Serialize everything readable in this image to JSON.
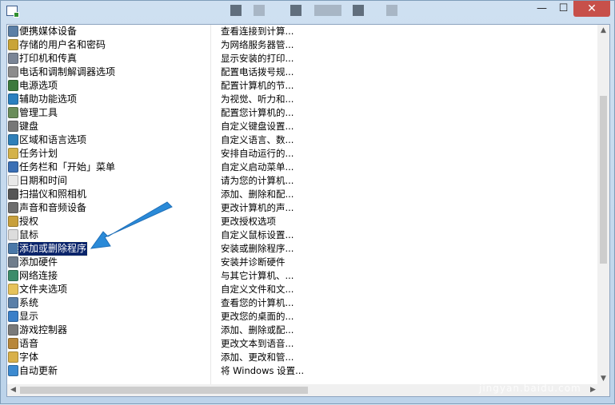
{
  "titlebar": {
    "min_label": "—",
    "max_label": "☐",
    "close_label": "✕"
  },
  "list": {
    "items": [
      {
        "name": "便携媒体设备",
        "desc": "查看连接到计算...",
        "icon": "portable-device-icon",
        "color": "#5b7fa6"
      },
      {
        "name": "存储的用户名和密码",
        "desc": "为网络服务器管...",
        "icon": "key-icon",
        "color": "#c9a437"
      },
      {
        "name": "打印机和传真",
        "desc": "显示安装的打印...",
        "icon": "printer-icon",
        "color": "#7a8596"
      },
      {
        "name": "电话和调制解调器选项",
        "desc": "配置电话拨号规...",
        "icon": "phone-icon",
        "color": "#8c8c8c"
      },
      {
        "name": "电源选项",
        "desc": "配置计算机的节...",
        "icon": "power-icon",
        "color": "#3c7a3c"
      },
      {
        "name": "辅助功能选项",
        "desc": "为视觉、听力和...",
        "icon": "accessibility-icon",
        "color": "#2a7fbf"
      },
      {
        "name": "管理工具",
        "desc": "配置您计算机的...",
        "icon": "admin-tools-icon",
        "color": "#6a8d5a"
      },
      {
        "name": "键盘",
        "desc": "自定义键盘设置...",
        "icon": "keyboard-icon",
        "color": "#777777"
      },
      {
        "name": "区域和语言选项",
        "desc": "自定义语言、数...",
        "icon": "globe-icon",
        "color": "#2f7fb8"
      },
      {
        "name": "任务计划",
        "desc": "安排自动运行的...",
        "icon": "task-scheduler-icon",
        "color": "#d4b24a"
      },
      {
        "name": "任务栏和「开始」菜单",
        "desc": "自定义启动菜单...",
        "icon": "taskbar-icon",
        "color": "#3a6fb5"
      },
      {
        "name": "日期和时间",
        "desc": "请为您的计算机...",
        "icon": "clock-icon",
        "color": "#e9e9e9"
      },
      {
        "name": "扫描仪和照相机",
        "desc": "添加、删除和配...",
        "icon": "scanner-icon",
        "color": "#555555"
      },
      {
        "name": "声音和音频设备",
        "desc": "更改计算机的声...",
        "icon": "speaker-icon",
        "color": "#6e6e6e"
      },
      {
        "name": "授权",
        "desc": "更改授权选项",
        "icon": "license-icon",
        "color": "#c8a03c"
      },
      {
        "name": "鼠标",
        "desc": "自定义鼠标设置...",
        "icon": "mouse-icon",
        "color": "#dcdcdc"
      },
      {
        "name": "添加或删除程序",
        "desc": "安装或删除程序...",
        "icon": "add-remove-programs-icon",
        "color": "#4a78a8",
        "selected": true
      },
      {
        "name": "添加硬件",
        "desc": "安装并诊断硬件",
        "icon": "add-hardware-icon",
        "color": "#6f7d8c"
      },
      {
        "name": "网络连接",
        "desc": "与其它计算机、...",
        "icon": "network-icon",
        "color": "#3c8c6a"
      },
      {
        "name": "文件夹选项",
        "desc": "自定义文件和文...",
        "icon": "folder-icon",
        "color": "#e6c25a"
      },
      {
        "name": "系统",
        "desc": "查看您的计算机...",
        "icon": "system-icon",
        "color": "#5a7fa8"
      },
      {
        "name": "显示",
        "desc": "更改您的桌面的...",
        "icon": "display-icon",
        "color": "#3a7fc8"
      },
      {
        "name": "游戏控制器",
        "desc": "添加、删除或配...",
        "icon": "game-controller-icon",
        "color": "#7a7a7a"
      },
      {
        "name": "语音",
        "desc": "更改文本到语音...",
        "icon": "speech-icon",
        "color": "#b8873a"
      },
      {
        "name": "字体",
        "desc": "添加、更改和管...",
        "icon": "fonts-icon",
        "color": "#d8b04a"
      },
      {
        "name": "自动更新",
        "desc": "将 Windows 设置...",
        "icon": "auto-update-icon",
        "color": "#3c8ad0"
      }
    ]
  },
  "scrollbars": {
    "vertical_position": 0.35,
    "up_arrow": "▲",
    "down_arrow": "▼",
    "left_arrow": "◀",
    "right_arrow": "▶"
  },
  "watermark": {
    "logo_text": "Baidu经验",
    "url_text": "jingyan.baidu.com"
  },
  "colors": {
    "selection": "#0a246a",
    "arrow": "#2a8ad8",
    "close_button": "#c7504a"
  }
}
